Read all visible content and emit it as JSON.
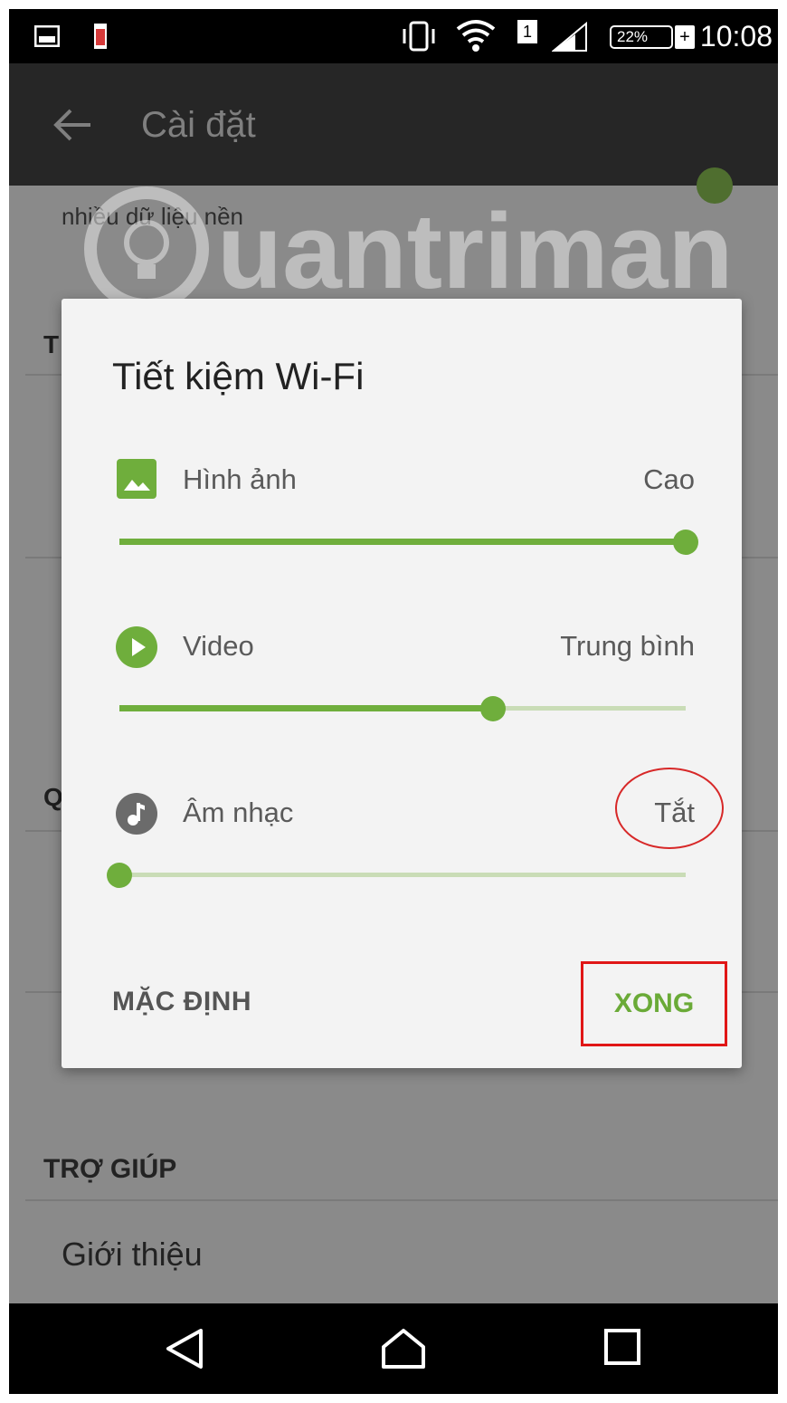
{
  "status_bar": {
    "time": "10:08",
    "battery": "22%",
    "sim_slot": "1",
    "icons": [
      "gallery-notification-icon",
      "battery-alert-icon",
      "vibrate-icon",
      "wifi-icon",
      "sim-icon",
      "signal-icon",
      "battery-icon",
      "charging-icon"
    ]
  },
  "app_bar": {
    "title": "Cài đặt",
    "back_icon": "back-arrow-icon"
  },
  "background": {
    "partial_desc": "nhiều dữ liệu nền",
    "section_letter_1": "T",
    "section_letter_2": "Q",
    "help_section": "TRỢ GIÚP",
    "about_item": "Giới thiệu"
  },
  "watermark": {
    "text": "uantrimang"
  },
  "dialog": {
    "title": "Tiết kiệm Wi-Fi",
    "options": [
      {
        "icon": "image-icon",
        "label": "Hình ảnh",
        "value": "Cao",
        "level": 1.0
      },
      {
        "icon": "play-icon",
        "label": "Video",
        "value": "Trung bình",
        "level": 0.66
      },
      {
        "icon": "music-note-icon",
        "label": "Âm nhạc",
        "value": "Tắt",
        "level": 0.0
      }
    ],
    "default_button": "MẶC ĐỊNH",
    "done_button": "XONG"
  },
  "colors": {
    "accent": "#6fae3c",
    "annotation": "#e01616"
  },
  "nav_bar": {
    "icons": [
      "back-icon",
      "home-icon",
      "recents-icon"
    ]
  }
}
